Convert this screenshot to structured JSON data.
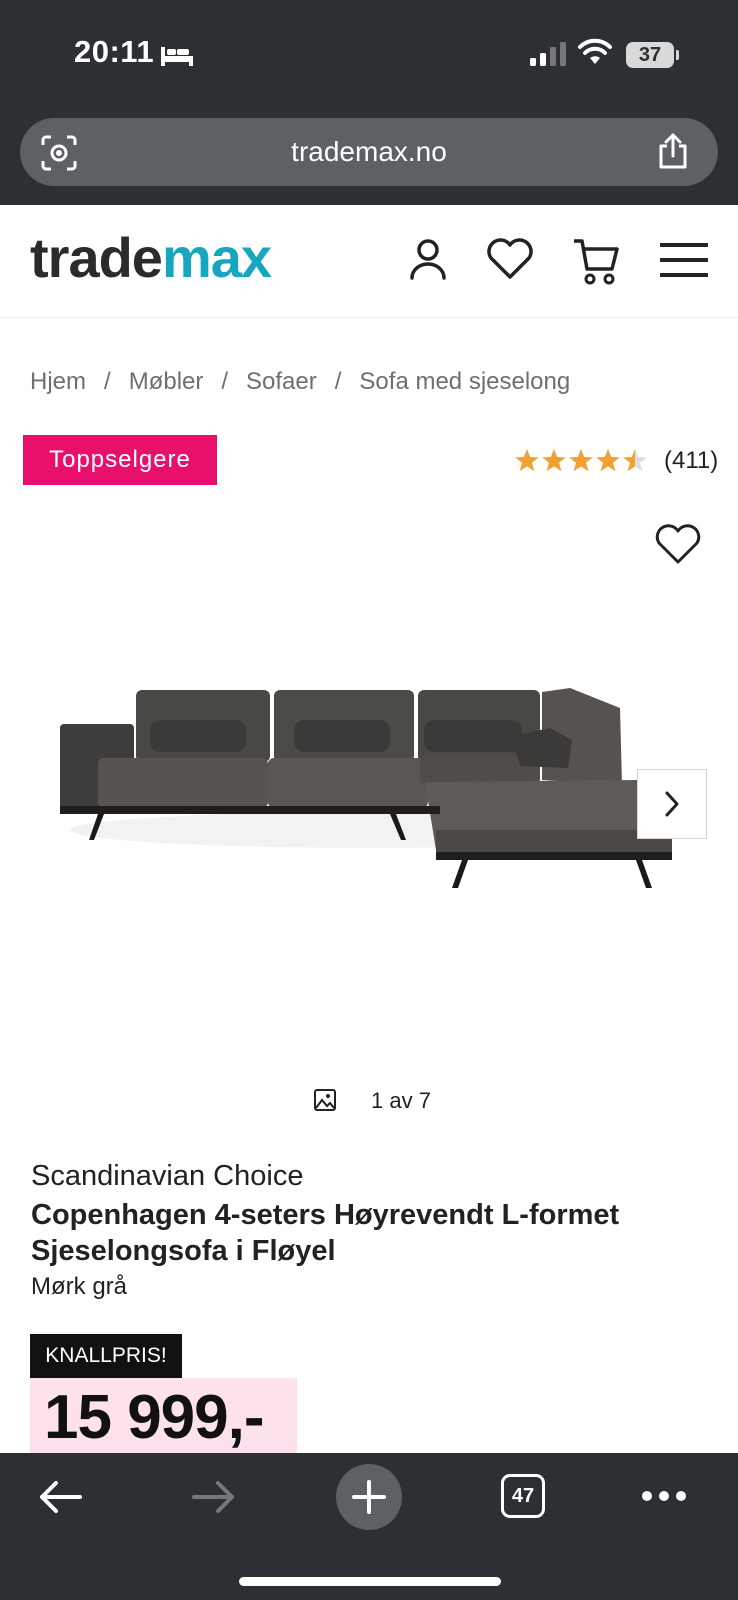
{
  "status_bar": {
    "time": "20:11",
    "battery": "37"
  },
  "browser": {
    "url": "trademax.no",
    "tab_count": "47"
  },
  "site": {
    "logo_part1": "trade",
    "logo_part2": "max"
  },
  "breadcrumb": [
    "Hjem",
    "Møbler",
    "Sofaer",
    "Sofa med sjeselong"
  ],
  "breadcrumb_separator": "/",
  "badge": "Toppselgere",
  "rating": {
    "stars": 4.5,
    "count": "(411)"
  },
  "gallery": {
    "counter": "1 av 7"
  },
  "product": {
    "brand": "Scandinavian Choice",
    "title": "Copenhagen 4-seters Høyrevendt L-formet Sjeselongsofa i Fløyel",
    "variant": "Mørk grå",
    "deal_label": "KNALLPRIS!",
    "price": "15 999,-"
  },
  "colors": {
    "brand_teal": "#16a6bf",
    "badge_pink": "#e8106b",
    "star": "#f0a132",
    "price_bg": "#fde2ee"
  },
  "icons": [
    "bed-icon",
    "signal-icon",
    "wifi-icon",
    "lens-icon",
    "share-icon",
    "user-icon",
    "heart-icon",
    "cart-icon",
    "menu-icon",
    "image-icon",
    "chevron-right-icon",
    "back-icon",
    "forward-icon",
    "plus-icon",
    "more-icon"
  ]
}
